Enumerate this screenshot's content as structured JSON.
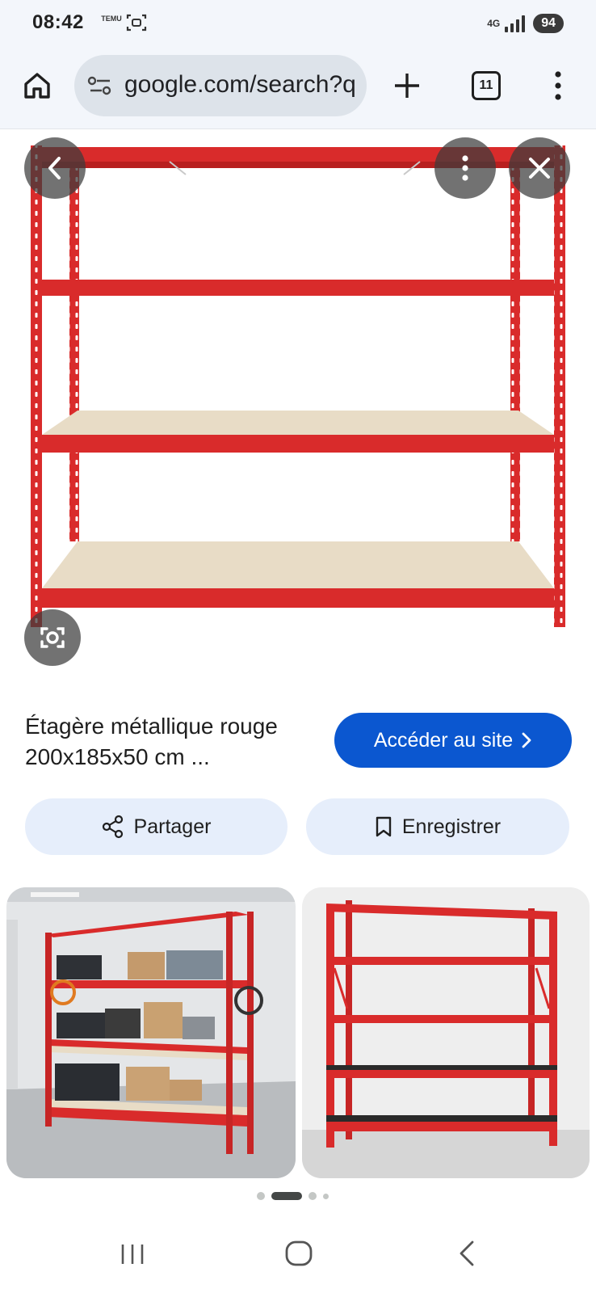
{
  "status_bar": {
    "time": "08:42",
    "app_badge": "TEMU",
    "network": "4G",
    "battery": "94"
  },
  "toolbar": {
    "url": "google.com/search?q",
    "tab_count": "11",
    "icons": [
      "home-icon",
      "tune-icon",
      "plus-icon",
      "tabs-icon",
      "more-vert-icon"
    ]
  },
  "viewer": {
    "icons": [
      "chevron-left-icon",
      "more-vert-icon",
      "close-icon",
      "lens-icon"
    ]
  },
  "result": {
    "title": "Étagère métallique rouge 200x185x50 cm ...",
    "visit_label": "Accéder au site",
    "share_label": "Partager",
    "save_label": "Enregistrer"
  },
  "pager": {
    "count": 4,
    "active": 1
  },
  "colors": {
    "accent": "#0b57d0",
    "shelf_red": "#d92b2b",
    "board": "#e8dcc6",
    "chip_bg": "#e6eefb"
  }
}
